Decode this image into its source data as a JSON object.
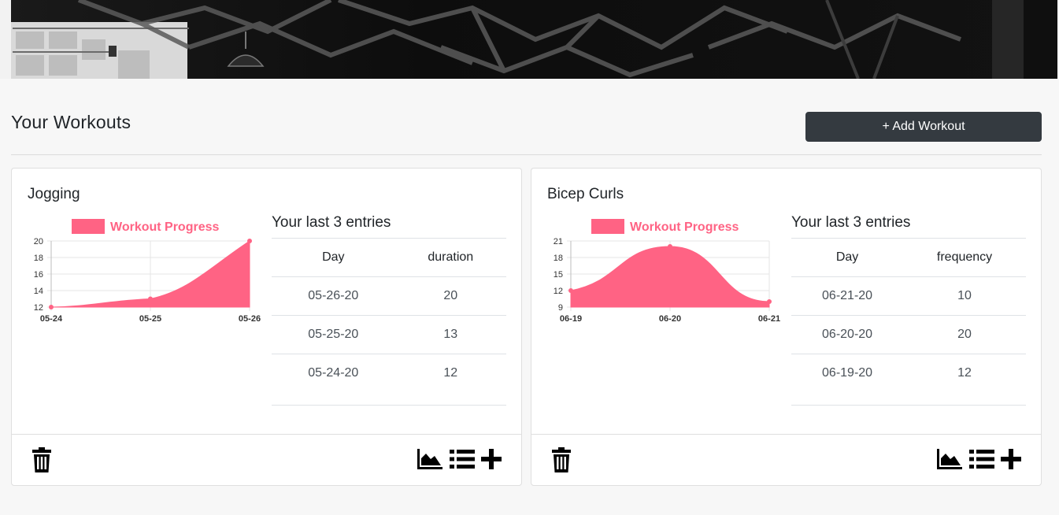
{
  "page": {
    "title": "Your Workouts",
    "add_button_label": "+ Add Workout"
  },
  "colors": {
    "accent": "#ff6384",
    "button_dark": "#343a40",
    "background": "#f7f7f7"
  },
  "icons": {
    "delete": "trash-icon",
    "chart": "area-chart-icon",
    "list": "list-icon",
    "add": "plus-icon"
  },
  "workouts": [
    {
      "name": "Jogging",
      "entries_title": "Your last 3 entries",
      "columns": [
        "Day",
        "duration"
      ],
      "rows": [
        [
          "05-26-20",
          "20"
        ],
        [
          "05-25-20",
          "13"
        ],
        [
          "05-24-20",
          "12"
        ]
      ],
      "chart_data": {
        "type": "area",
        "title": "",
        "legend": "Workout Progress",
        "legend_position": "top",
        "grid": true,
        "categories": [
          "05-24",
          "05-25",
          "05-26"
        ],
        "series": [
          {
            "name": "Workout Progress",
            "values": [
              12,
              13,
              20
            ]
          }
        ],
        "y_ticks": [
          12,
          14,
          16,
          18,
          20
        ],
        "ylim": [
          12,
          20
        ],
        "curve": "cubic-monotone"
      }
    },
    {
      "name": "Bicep Curls",
      "entries_title": "Your last 3 entries",
      "columns": [
        "Day",
        "frequency"
      ],
      "rows": [
        [
          "06-21-20",
          "10"
        ],
        [
          "06-20-20",
          "20"
        ],
        [
          "06-19-20",
          "12"
        ]
      ],
      "chart_data": {
        "type": "area",
        "title": "",
        "legend": "Workout Progress",
        "legend_position": "top",
        "grid": true,
        "categories": [
          "06-19",
          "06-20",
          "06-21"
        ],
        "series": [
          {
            "name": "Workout Progress",
            "values": [
              12,
              20,
              10
            ]
          }
        ],
        "y_ticks": [
          9,
          12,
          15,
          18,
          21
        ],
        "ylim": [
          9,
          21
        ],
        "curve": "smooth"
      }
    }
  ]
}
